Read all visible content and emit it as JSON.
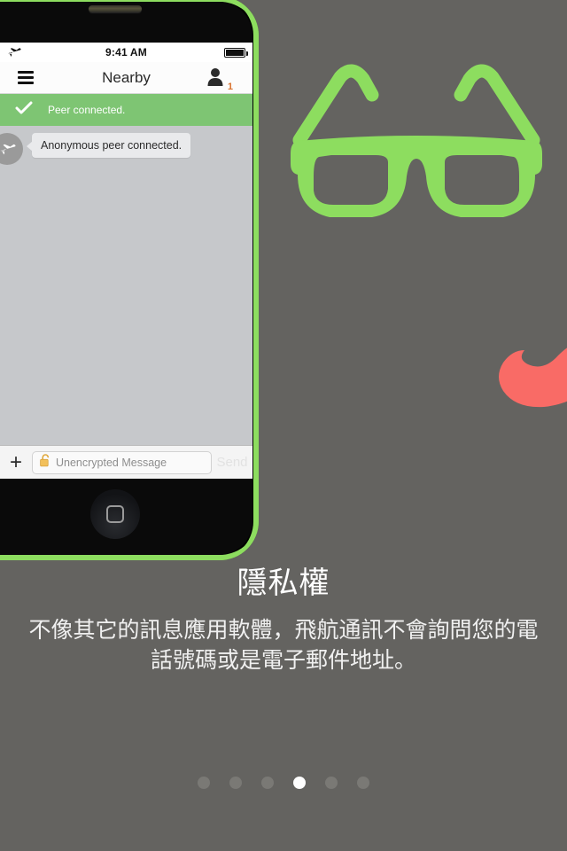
{
  "background_color": "#646360",
  "accent_green": "#8ddd5f",
  "accent_coral": "#f96b66",
  "decor": {
    "glasses_icon": "nerd-glasses-icon",
    "glasses_color": "#8ddd5f",
    "mustache_icon": "mustache-icon",
    "mustache_color": "#f96b66"
  },
  "phone": {
    "earpiece": "earpiece-speaker",
    "home_button": "home-button"
  },
  "app": {
    "statusbar": {
      "airplane_icon": "airplane-mode-icon",
      "time": "9:41 AM",
      "battery_icon": "battery-full-icon"
    },
    "navbar": {
      "menu_icon": "hamburger-menu-icon",
      "title": "Nearby",
      "people_icon": "person-icon",
      "people_count": "1",
      "badge_color": "#d9722e"
    },
    "toast": {
      "check_icon": "checkmark-icon",
      "text": "Peer connected.",
      "color": "#7ec573"
    },
    "messages": [
      {
        "avatar_icon": "airplane-icon",
        "text": "Anonymous peer connected."
      }
    ],
    "composer": {
      "add_label": "+",
      "lock_icon": "unlocked-padlock-icon",
      "placeholder": "Unencrypted Message",
      "value": "",
      "send_label": "Send"
    }
  },
  "onboarding": {
    "title": "隱私權",
    "body": "不像其它的訊息應用軟體，飛航通訊不會詢問您的電話號碼或是電子郵件地址。",
    "pager": {
      "total": 6,
      "active_index": 4
    }
  }
}
